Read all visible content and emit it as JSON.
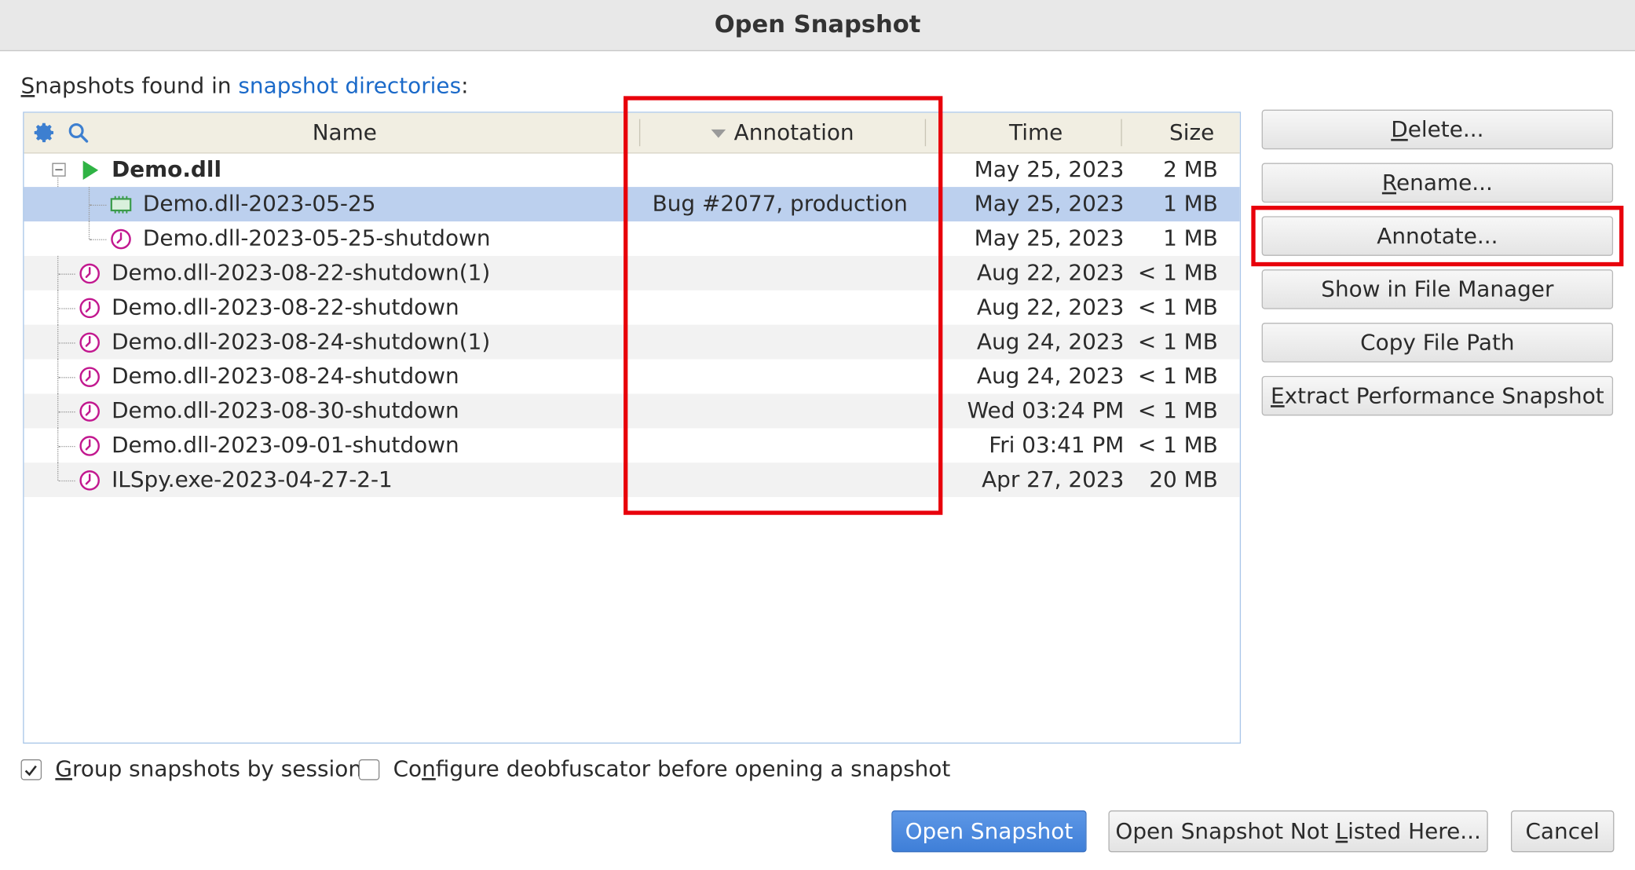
{
  "window": {
    "title": "Open Snapshot"
  },
  "intro": {
    "prefix": "Snapshots found in ",
    "link": "snapshot directories",
    "suffix": ":"
  },
  "columns": {
    "name": "Name",
    "annotation": "Annotation",
    "time": "Time",
    "size": "Size"
  },
  "rows": [
    {
      "name": "Demo.dll",
      "annotation": "",
      "time": "May 25, 2023",
      "size": "2 MB",
      "icon": "run-icon",
      "level": 0,
      "group": true
    },
    {
      "name": "Demo.dll-2023-05-25",
      "annotation": "Bug #2077, production",
      "time": "May 25, 2023",
      "size": "1 MB",
      "icon": "memory-snapshot-icon",
      "level": 1,
      "selected": true
    },
    {
      "name": "Demo.dll-2023-05-25-shutdown",
      "annotation": "",
      "time": "May 25, 2023",
      "size": "1 MB",
      "icon": "clock-icon",
      "level": 1
    },
    {
      "name": "Demo.dll-2023-08-22-shutdown(1)",
      "annotation": "",
      "time": "Aug 22, 2023",
      "size": "< 1 MB",
      "icon": "clock-icon",
      "level": 0
    },
    {
      "name": "Demo.dll-2023-08-22-shutdown",
      "annotation": "",
      "time": "Aug 22, 2023",
      "size": "< 1 MB",
      "icon": "clock-icon",
      "level": 0
    },
    {
      "name": "Demo.dll-2023-08-24-shutdown(1)",
      "annotation": "",
      "time": "Aug 24, 2023",
      "size": "< 1 MB",
      "icon": "clock-icon",
      "level": 0
    },
    {
      "name": "Demo.dll-2023-08-24-shutdown",
      "annotation": "",
      "time": "Aug 24, 2023",
      "size": "< 1 MB",
      "icon": "clock-icon",
      "level": 0
    },
    {
      "name": "Demo.dll-2023-08-30-shutdown",
      "annotation": "",
      "time": "Wed 03:24 PM",
      "size": "< 1 MB",
      "icon": "clock-icon",
      "level": 0
    },
    {
      "name": "Demo.dll-2023-09-01-shutdown",
      "annotation": "",
      "time": "Fri 03:41 PM",
      "size": "< 1 MB",
      "icon": "clock-icon",
      "level": 0
    },
    {
      "name": "ILSpy.exe-2023-04-27-2-1",
      "annotation": "",
      "time": "Apr 27, 2023",
      "size": "20 MB",
      "icon": "clock-icon",
      "level": 0
    }
  ],
  "side_buttons": {
    "delete": {
      "mnemonic": "D",
      "rest": "elete..."
    },
    "rename": {
      "mnemonic": "R",
      "rest": "ename..."
    },
    "annotate": "Annotate...",
    "show_in_file_manager": "Show in File Manager",
    "copy_file_path": "Copy File Path",
    "extract": {
      "mnemonic": "E",
      "rest": "xtract Performance Snapshot"
    }
  },
  "options": {
    "group_by_session": {
      "pre": "",
      "mnemonic": "G",
      "rest": "roup snapshots by session",
      "checked": true
    },
    "configure_deobfuscator": {
      "pre": "Co",
      "mnemonic": "n",
      "rest": "figure deobfuscator before opening a snapshot",
      "checked": false
    }
  },
  "footer": {
    "open": "Open Snapshot",
    "open_not_listed": {
      "pre": "Open Snapshot Not ",
      "mnemonic": "L",
      "rest": "isted Here..."
    },
    "cancel": "Cancel"
  },
  "colors": {
    "accent": "#3f7fd8",
    "selection": "#bcd0ee",
    "highlight": "#e8000b",
    "link": "#1b6ac9"
  }
}
